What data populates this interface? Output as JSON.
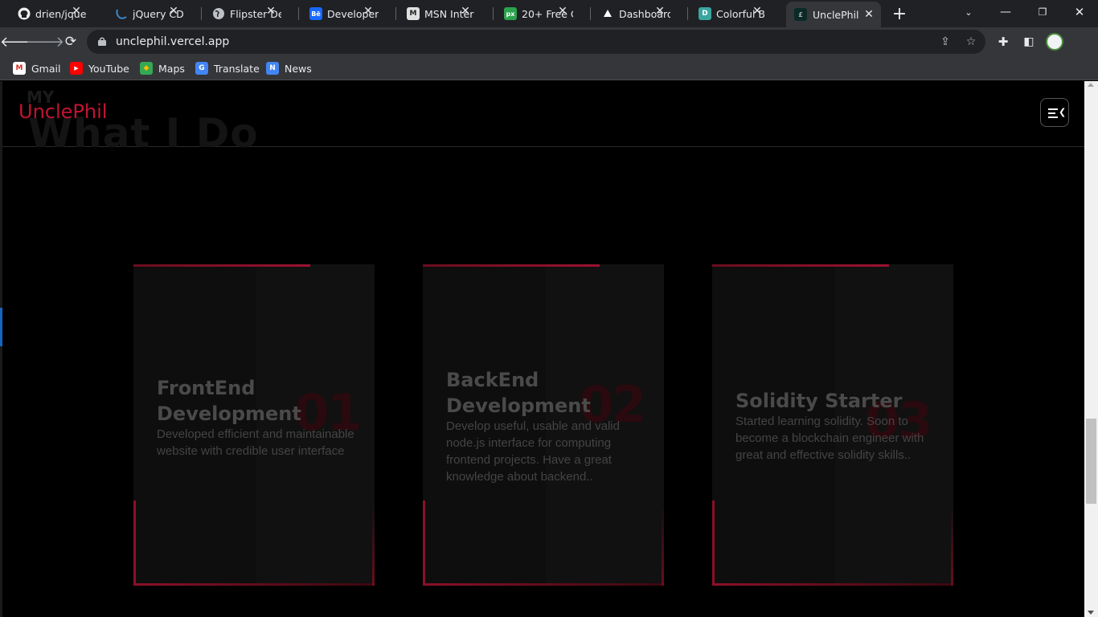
{
  "browser": {
    "tabs": [
      {
        "title": "drien/jque",
        "icon": "github-icon",
        "fav_color": "#f0f0f0"
      },
      {
        "title": "jQuery CD",
        "icon": "jquery-icon",
        "fav_color": "#0e76bd"
      },
      {
        "title": "Flipster De",
        "icon": "globe-icon",
        "fav_color": "#9aa0a6"
      },
      {
        "title": "Developer",
        "icon": "behance-icon",
        "fav_color": "#1769ff"
      },
      {
        "title": "MSN Inter",
        "icon": "msn-icon",
        "fav_color": "#d0d0d0"
      },
      {
        "title": "20+ Free C",
        "icon": "px-icon",
        "fav_color": "#2ca24e"
      },
      {
        "title": "Dashboard",
        "icon": "vercel-icon",
        "fav_color": "#ffffff"
      },
      {
        "title": "Colorful B",
        "icon": "d-icon",
        "fav_color": "#3aa6a0"
      },
      {
        "title": "UnclePhil",
        "icon": "unclephil-icon",
        "fav_color": "#1a1a1a"
      }
    ],
    "url": "unclephil.vercel.app",
    "bookmarks": [
      {
        "label": "Gmail",
        "icon": "gmail-icon"
      },
      {
        "label": "YouTube",
        "icon": "youtube-icon"
      },
      {
        "label": "Maps",
        "icon": "maps-icon"
      },
      {
        "label": "Translate",
        "icon": "translate-icon"
      },
      {
        "label": "News",
        "icon": "news-icon"
      }
    ]
  },
  "page": {
    "bg_small": "MY",
    "bg_title": "What I Do",
    "logo": "UnclePhil",
    "accent": "#c01432",
    "cards": [
      {
        "title": "FrontEnd Development",
        "number": "01",
        "description": "Developed efficient and maintainable website with credible user interface"
      },
      {
        "title": "BackEnd Development",
        "number": "02",
        "description": "Develop useful, usable and valid node.js interface for computing frontend projects. Have a great knowledge about backend.."
      },
      {
        "title": "Solidity Starter",
        "number": "03",
        "description": "Started learning solidity. Soon to become a blockchain engineer with great and effective solidity skills.."
      }
    ]
  }
}
